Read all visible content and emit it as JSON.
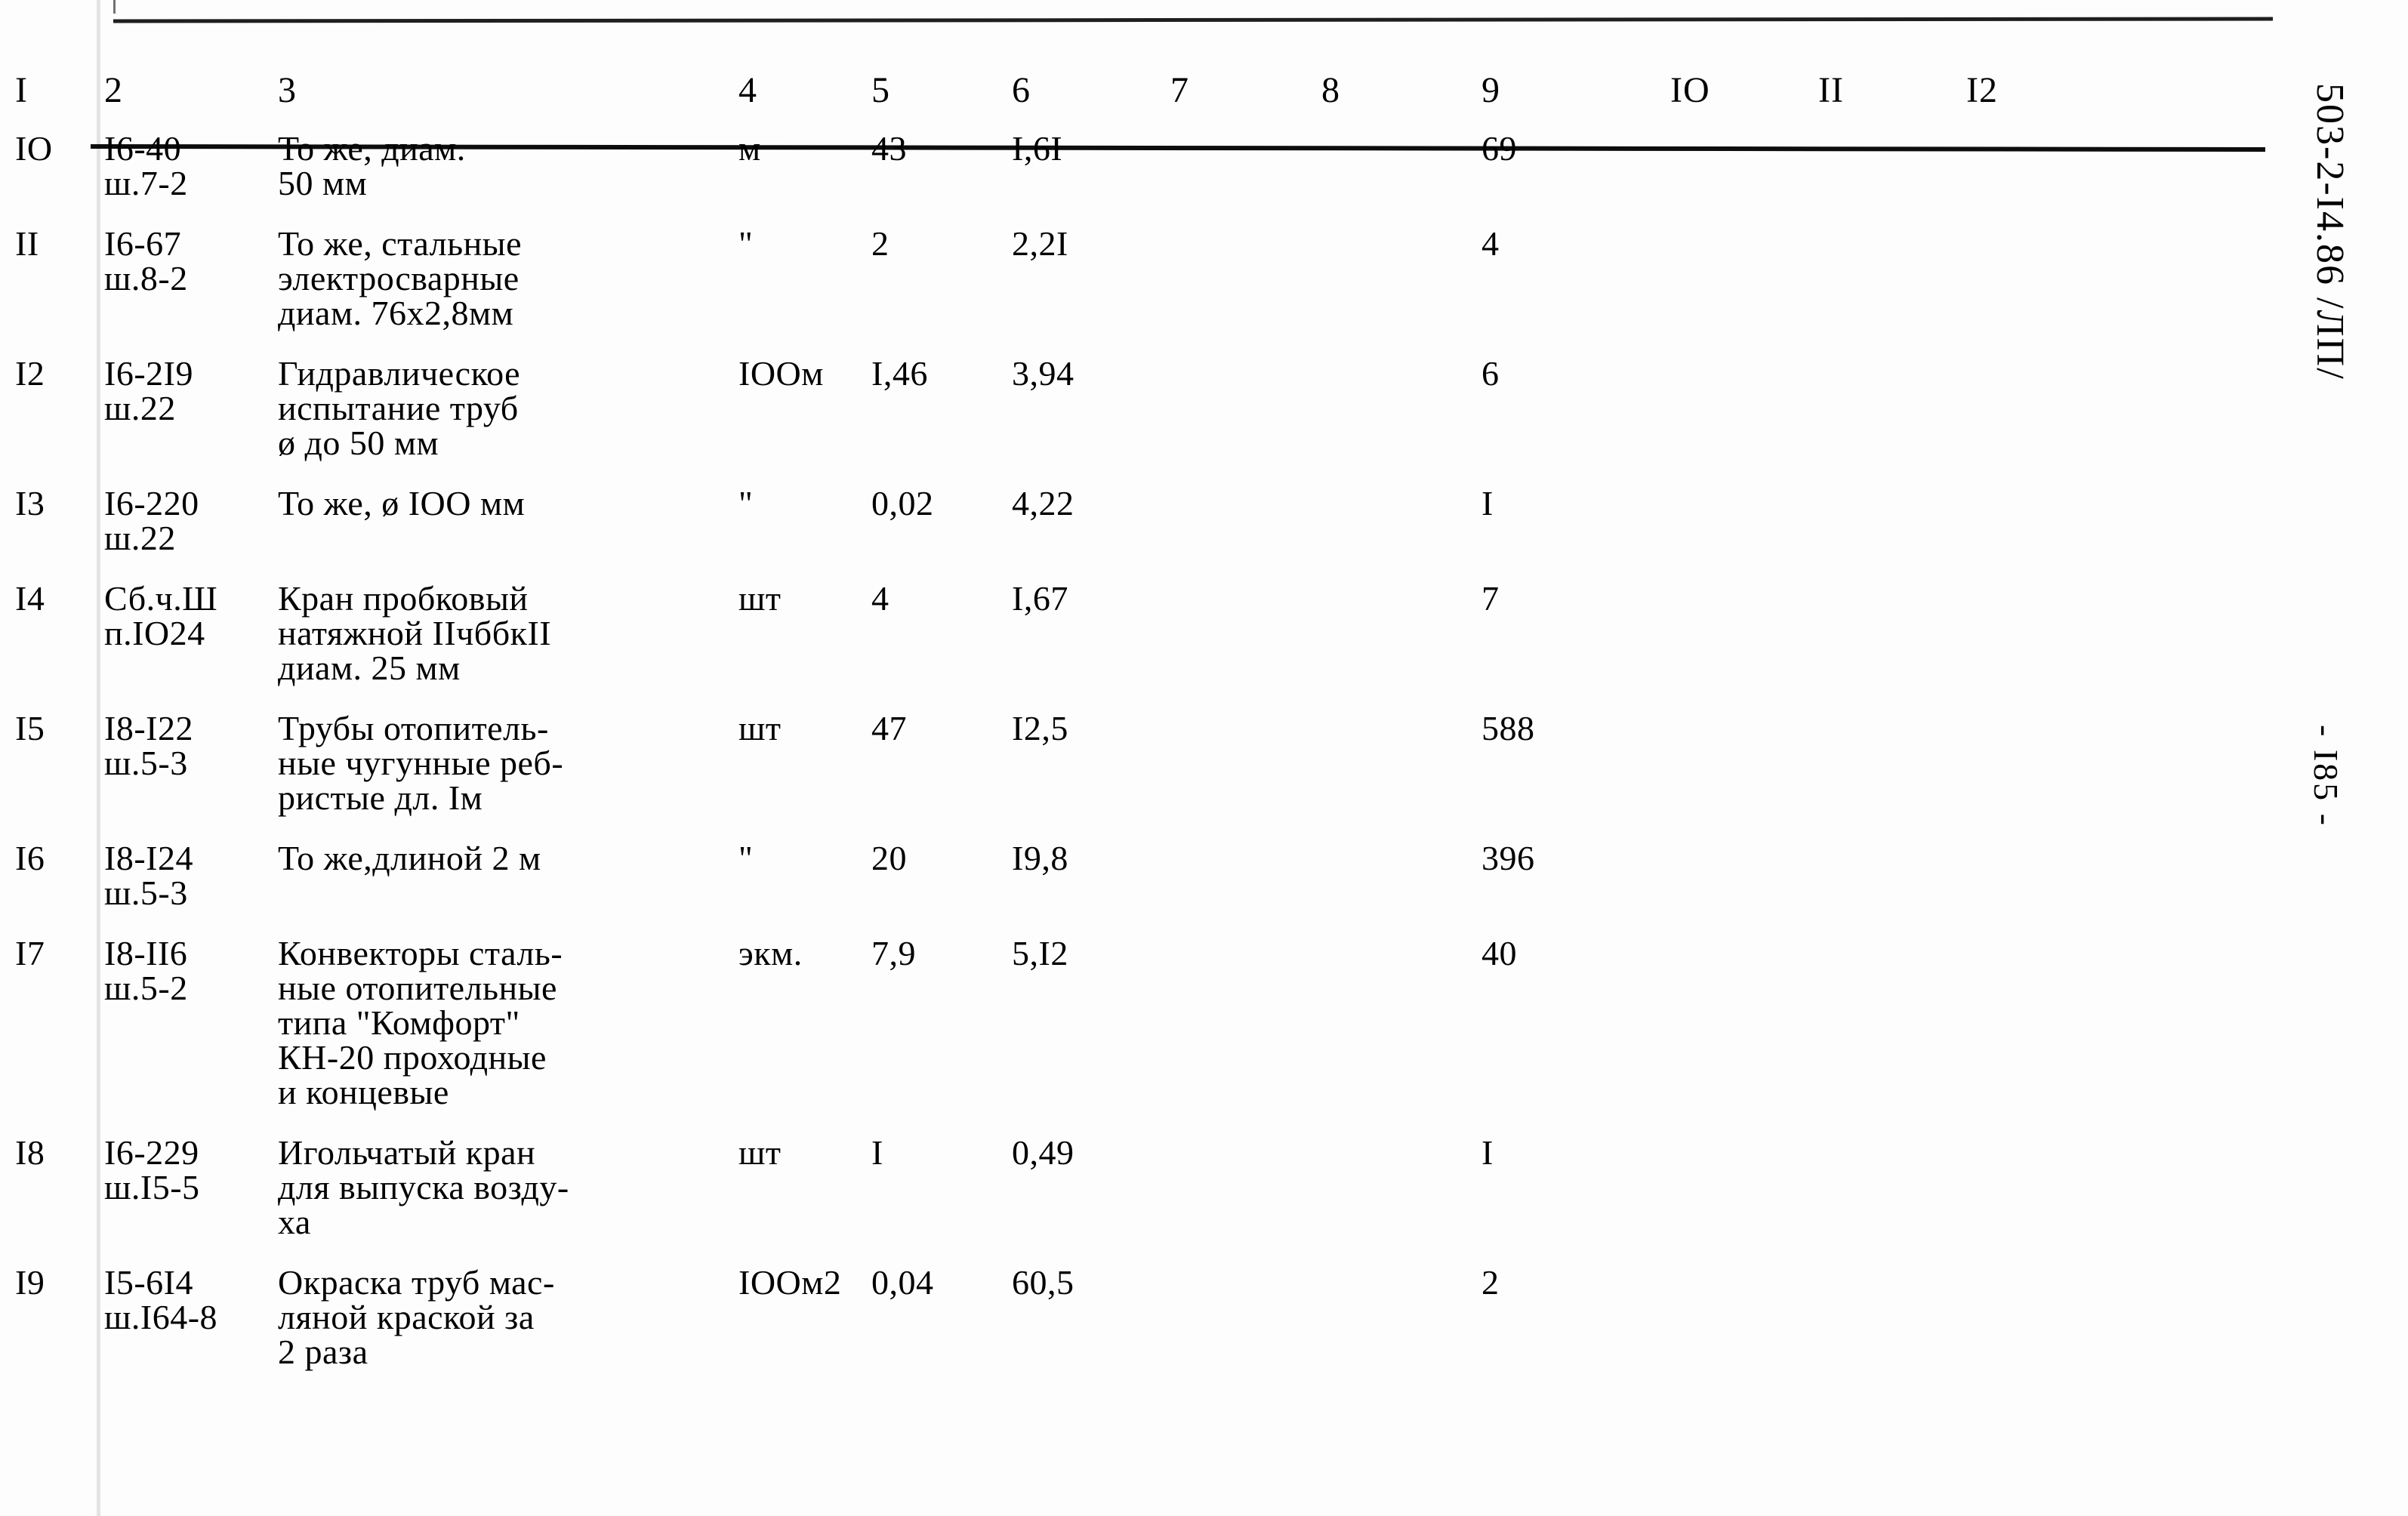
{
  "document": {
    "code_label": "503-2-I4.86 /ЛП/",
    "page_label": "- I85 -"
  },
  "table": {
    "column_headers": [
      "I",
      "2",
      "3",
      "4",
      "5",
      "6",
      "7",
      "8",
      "9",
      "IO",
      "II",
      "I2"
    ],
    "rows": [
      {
        "num": "IO",
        "code": [
          "I6-40",
          "ш.7-2"
        ],
        "desc": [
          "То же, диам.",
          "50 мм"
        ],
        "unit": "м",
        "qty": "43",
        "price": "I,6I",
        "col7": "",
        "col8": "",
        "total": "69",
        "col10": "",
        "col11": "",
        "col12": ""
      },
      {
        "num": "II",
        "code": [
          "I6-67",
          "ш.8-2"
        ],
        "desc": [
          "То же, стальные",
          "электросварные",
          "диам. 76х2,8мм"
        ],
        "unit": "\"",
        "qty": "2",
        "price": "2,2I",
        "col7": "",
        "col8": "",
        "total": "4",
        "col10": "",
        "col11": "",
        "col12": ""
      },
      {
        "num": "I2",
        "code": [
          "I6-2I9",
          "ш.22"
        ],
        "desc": [
          "Гидравлическое",
          "испытание труб",
          "ø до 50 мм"
        ],
        "unit": "IOOм",
        "qty": "I,46",
        "price": "3,94",
        "col7": "",
        "col8": "",
        "total": "6",
        "col10": "",
        "col11": "",
        "col12": ""
      },
      {
        "num": "I3",
        "code": [
          "I6-220",
          "ш.22"
        ],
        "desc": [
          "То же, ø IOO мм"
        ],
        "unit": "\"",
        "qty": "0,02",
        "price": "4,22",
        "col7": "",
        "col8": "",
        "total": "I",
        "col10": "",
        "col11": "",
        "col12": ""
      },
      {
        "num": "I4",
        "code": [
          "Сб.ч.Ш",
          "п.IO24"
        ],
        "desc": [
          "Кран пробковый",
          "натяжной IIчббкII",
          "диам. 25 мм"
        ],
        "unit": "шт",
        "qty": "4",
        "price": "I,67",
        "col7": "",
        "col8": "",
        "total": "7",
        "col10": "",
        "col11": "",
        "col12": ""
      },
      {
        "num": "I5",
        "code": [
          "I8-I22",
          "ш.5-3"
        ],
        "desc": [
          "Трубы отопитель-",
          "ные чугунные реб-",
          "ристые дл. Iм"
        ],
        "unit": "шт",
        "qty": "47",
        "price": "I2,5",
        "col7": "",
        "col8": "",
        "total": "588",
        "col10": "",
        "col11": "",
        "col12": ""
      },
      {
        "num": "I6",
        "code": [
          "I8-I24",
          "ш.5-3"
        ],
        "desc": [
          "То же,длиной 2 м"
        ],
        "unit": "\"",
        "qty": "20",
        "price": "I9,8",
        "col7": "",
        "col8": "",
        "total": "396",
        "col10": "",
        "col11": "",
        "col12": ""
      },
      {
        "num": "I7",
        "code": [
          "I8-II6",
          "ш.5-2"
        ],
        "desc": [
          "Конвекторы сталь-",
          "ные отопительные",
          "типа \"Комфорт\"",
          "КН-20 проходные",
          "и концевые"
        ],
        "unit": "экм.",
        "qty": "7,9",
        "price": "5,I2",
        "col7": "",
        "col8": "",
        "total": "40",
        "col10": "",
        "col11": "",
        "col12": ""
      },
      {
        "num": "I8",
        "code": [
          "I6-229",
          "ш.I5-5"
        ],
        "desc": [
          "Игольчатый кран",
          "для выпуска возду-",
          "ха"
        ],
        "unit": "шт",
        "qty": "I",
        "price": "0,49",
        "col7": "",
        "col8": "",
        "total": "I",
        "col10": "",
        "col11": "",
        "col12": ""
      },
      {
        "num": "I9",
        "code": [
          "I5-6I4",
          "ш.I64-8"
        ],
        "desc": [
          "Окраска труб мас-",
          "ляной краской за",
          "2 раза"
        ],
        "unit": "IOOм2",
        "qty": "0,04",
        "price": "60,5",
        "col7": "",
        "col8": "",
        "total": "2",
        "col10": "",
        "col11": "",
        "col12": ""
      }
    ]
  }
}
